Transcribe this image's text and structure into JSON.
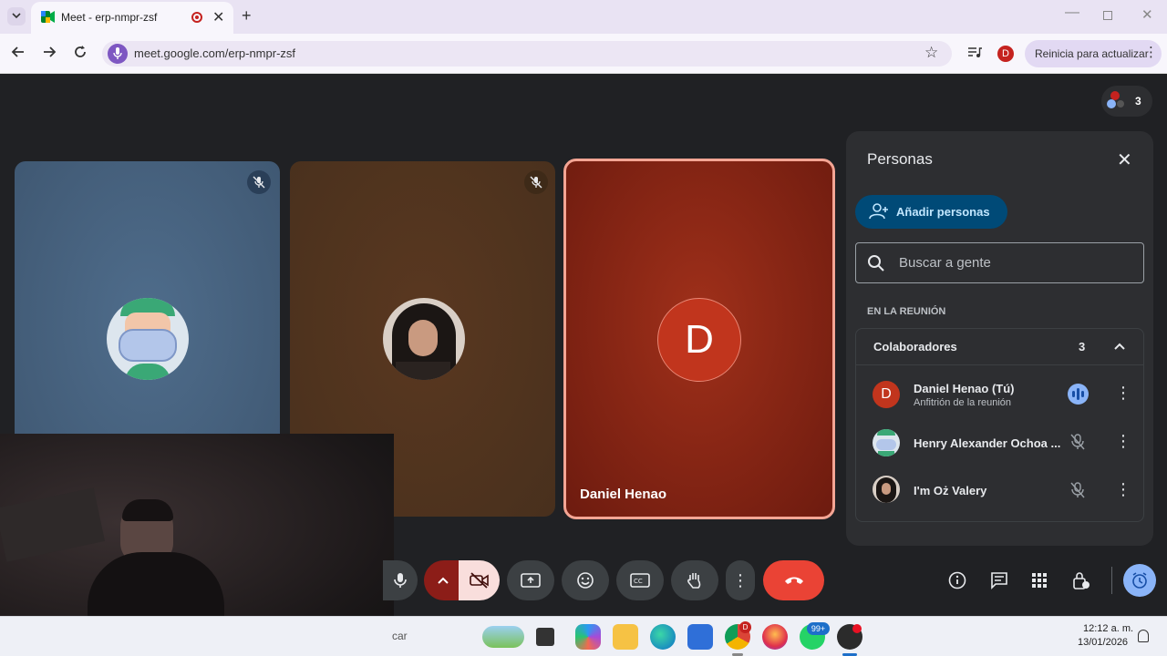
{
  "browser": {
    "tab_title": "Meet - erp-nmpr-zsf",
    "url": "meet.google.com/erp-nmpr-zsf",
    "profile_initial": "D",
    "update_button": "Reinicia para actualizar"
  },
  "meeting": {
    "participant_count": "3",
    "tiles": [
      {
        "name": "",
        "bg": "#47617c",
        "muted": true
      },
      {
        "name": "",
        "bg": "#4a2f1c",
        "muted": true
      },
      {
        "name": "Daniel Henao",
        "initial": "D",
        "bg": "#8a2414",
        "muted": false,
        "speaking": true
      }
    ]
  },
  "people_panel": {
    "title": "Personas",
    "add_button": "Añadir personas",
    "search_placeholder": "Buscar a gente",
    "section_label": "EN LA REUNIÓN",
    "group_label": "Colaboradores",
    "group_count": "3",
    "members": [
      {
        "name": "Daniel Henao (Tú)",
        "subtitle": "Anfitrión de la reunión",
        "initial": "D",
        "mic": "speaking-icon"
      },
      {
        "name": "Henry Alexander Ochoa ...",
        "subtitle": "",
        "initial": "",
        "mic": "mic-off-icon"
      },
      {
        "name": "I'm Oż Valery",
        "subtitle": "",
        "initial": "",
        "mic": "mic-off-icon"
      }
    ]
  },
  "taskbar": {
    "search_text": "car",
    "time": "12:12 a. m.",
    "date": "13/01/2026",
    "whatsapp_badge": "99+",
    "chrome_badge": "D"
  },
  "colors": {
    "accent": "#1a73e8",
    "hangup": "#ea4335",
    "panel": "#2d2e31",
    "speaking_border": "#f28b82"
  }
}
